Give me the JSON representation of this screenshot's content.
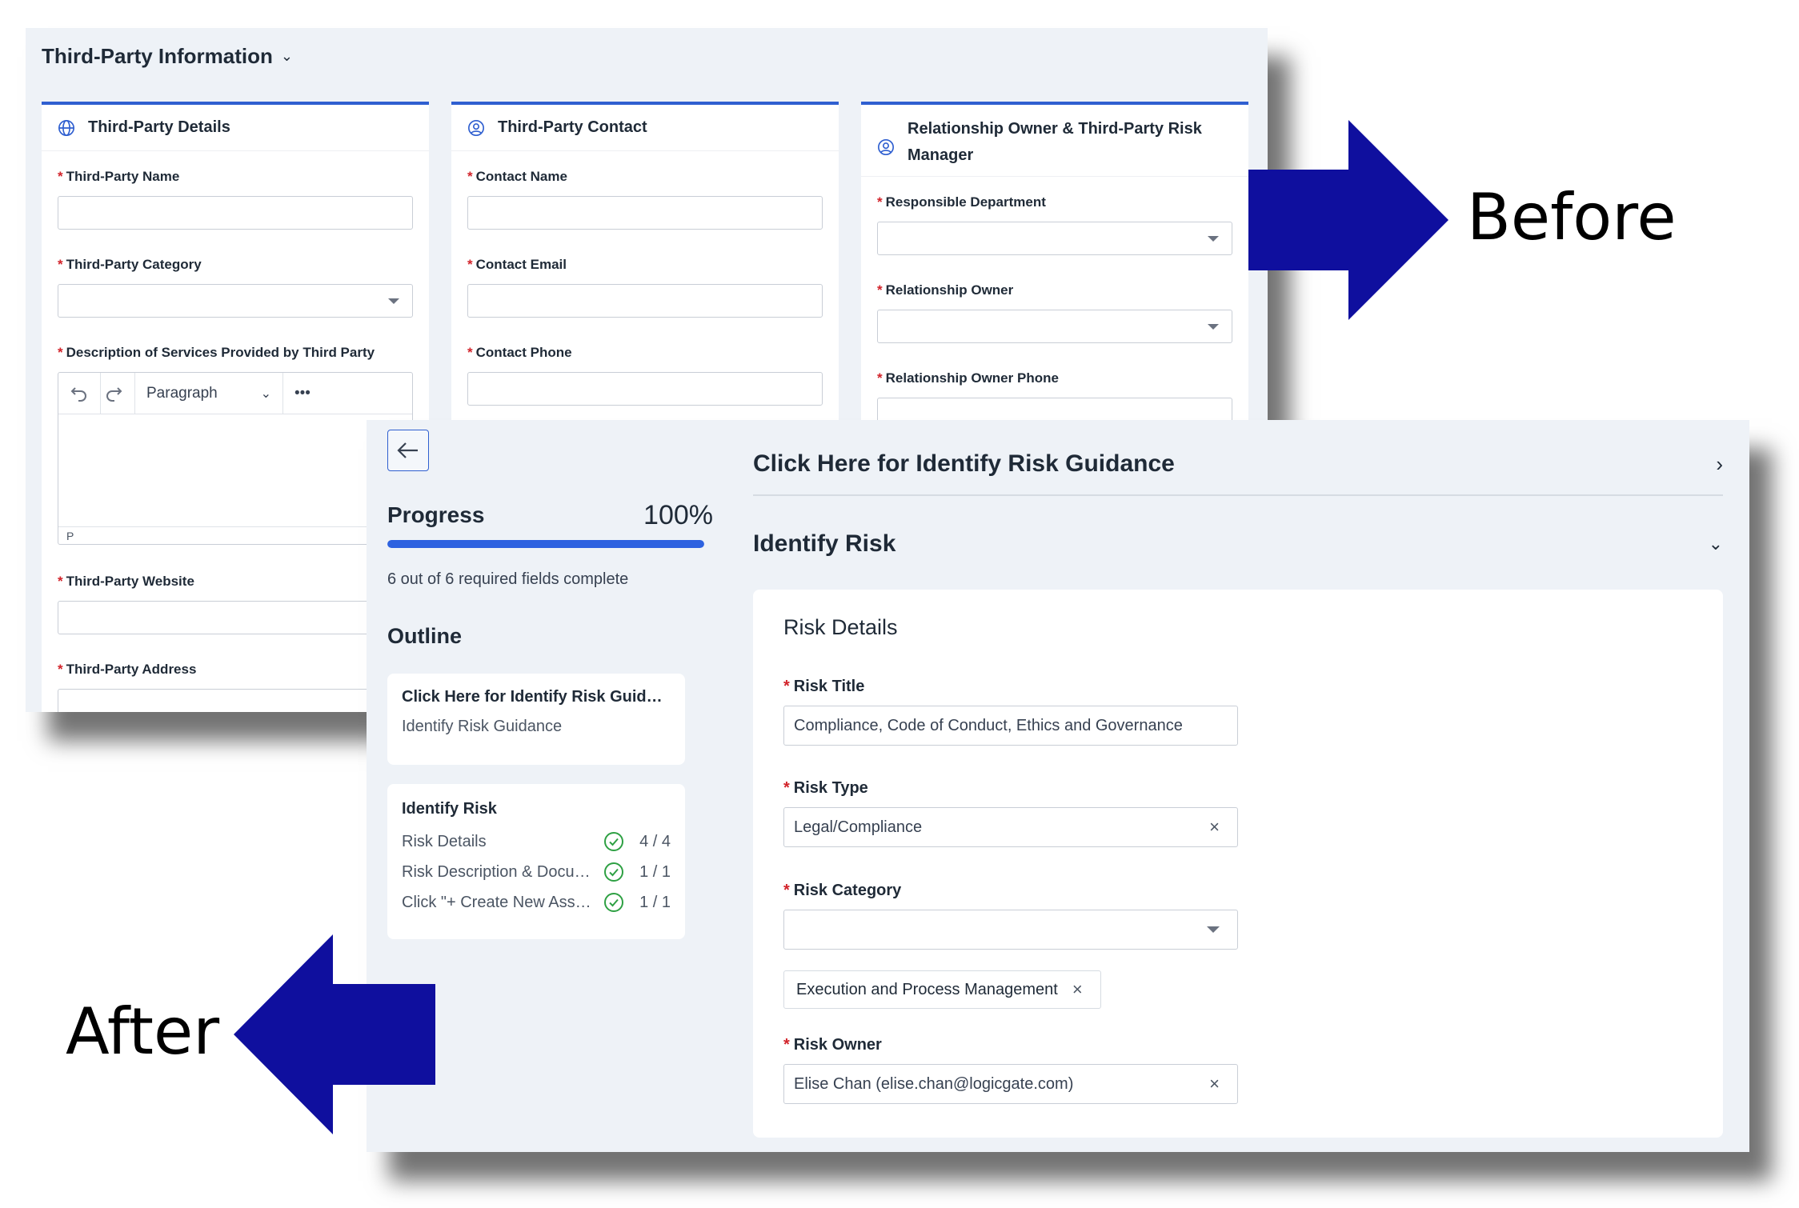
{
  "before": {
    "section_title": "Third-Party Information",
    "cards": [
      {
        "title": "Third-Party Details",
        "icon": "globe-icon",
        "fields": [
          {
            "label": "Third-Party Name",
            "type": "text",
            "value": ""
          },
          {
            "label": "Third-Party Category",
            "type": "select",
            "value": ""
          },
          {
            "label": "Description of Services Provided by Third Party",
            "type": "richtext",
            "value": ""
          },
          {
            "label": "Third-Party Website",
            "type": "text",
            "value": ""
          },
          {
            "label": "Third-Party Address",
            "type": "text",
            "value": ""
          }
        ]
      },
      {
        "title": "Third-Party Contact",
        "icon": "user-circle-icon",
        "fields": [
          {
            "label": "Contact Name",
            "type": "text",
            "value": ""
          },
          {
            "label": "Contact Email",
            "type": "text",
            "value": ""
          },
          {
            "label": "Contact Phone",
            "type": "text",
            "value": ""
          }
        ]
      },
      {
        "title": "Relationship Owner & Third-Party Risk Manager",
        "icon": "user-circle-icon",
        "fields": [
          {
            "label": "Responsible Department",
            "type": "select",
            "value": ""
          },
          {
            "label": "Relationship Owner",
            "type": "select",
            "value": ""
          },
          {
            "label": "Relationship Owner Phone",
            "type": "text",
            "value": ""
          }
        ]
      }
    ],
    "rte": {
      "format_label": "Paragraph",
      "more_label": "•••",
      "status": "P"
    }
  },
  "after": {
    "progress": {
      "label": "Progress",
      "value_text": "100%",
      "fraction": 1.0,
      "note": "6 out of 6 required fields complete"
    },
    "outline": {
      "title": "Outline",
      "guidance_card": {
        "title": "Click Here for Identify Risk Guidance",
        "sub": "Identify Risk Guidance"
      },
      "risk_card": {
        "title": "Identify Risk",
        "rows": [
          {
            "name": "Risk Details",
            "count": "4 / 4"
          },
          {
            "name": "Risk Description & Documentation",
            "count": "1 / 1"
          },
          {
            "name": "Click \"+ Create New Assessment\"",
            "count": "1 / 1"
          }
        ]
      }
    },
    "guidance_header": "Click Here for Identify Risk Guidance",
    "identify_header": "Identify Risk",
    "details": {
      "title": "Risk Details",
      "risk_title": {
        "label": "Risk Title",
        "value": "Compliance, Code of Conduct, Ethics and Governance"
      },
      "risk_type": {
        "label": "Risk Type",
        "value": "Legal/Compliance"
      },
      "risk_category": {
        "label": "Risk Category",
        "value": "",
        "chip": "Execution and Process Management"
      },
      "risk_owner": {
        "label": "Risk Owner",
        "value": "Elise Chan (elise.chan@logicgate.com)"
      }
    }
  },
  "labels": {
    "before": "Before",
    "after": "After"
  },
  "colors": {
    "accent": "#2f5fd0",
    "arrow": "#0f0f9e",
    "required": "#d2232a",
    "check": "#2ea043"
  }
}
